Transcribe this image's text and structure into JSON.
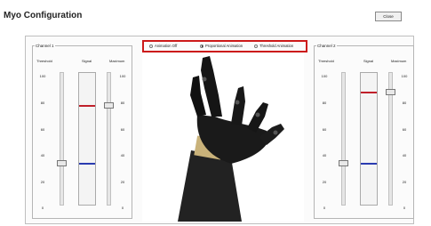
{
  "window": {
    "title": "Myo Configuration",
    "close_label": "Close"
  },
  "colors": {
    "max_line": "#c0202a",
    "threshold_line": "#2a3cb0",
    "highlight_border": "#cc1a1a"
  },
  "ticks": [
    "100",
    "80",
    "60",
    "40",
    "20",
    "0"
  ],
  "channels": [
    {
      "title": "Channel 1",
      "hdr_threshold": "Threshold",
      "hdr_signal": "Signal",
      "hdr_maximum": "Maximum",
      "threshold_level": 0.31,
      "max_level": 0.75
    },
    {
      "title": "Channel 2",
      "hdr_threshold": "Threshold",
      "hdr_signal": "Signal",
      "hdr_maximum": "Maximum",
      "threshold_level": 0.31,
      "max_level": 0.85
    }
  ],
  "animation_modes": {
    "options": [
      {
        "label": "Animation Off",
        "selected": false
      },
      {
        "label": "Proportional Animation",
        "selected": true
      },
      {
        "label": "Threshold Animation",
        "selected": false
      }
    ]
  },
  "viewer": {
    "icon": "robotic-hand-icon"
  }
}
